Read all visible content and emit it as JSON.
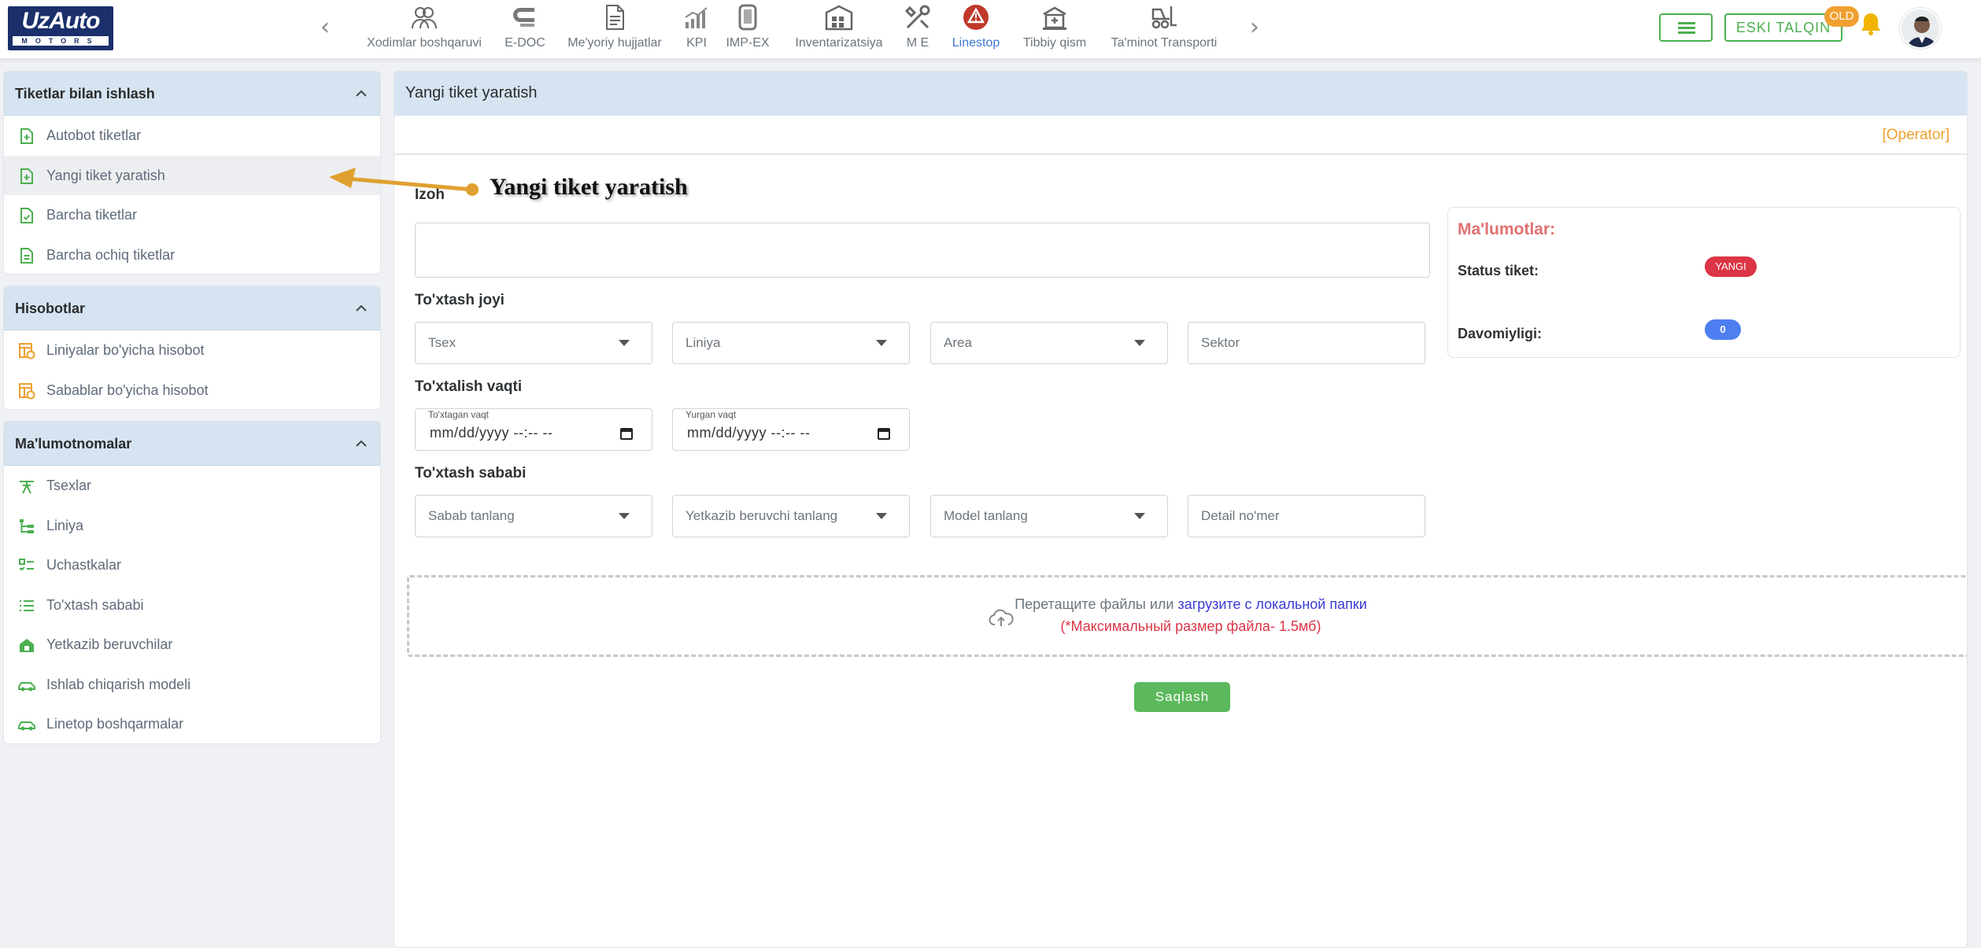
{
  "brand": {
    "name": "UzAuto",
    "sub": "MOTORS"
  },
  "nav": {
    "prev": "‹",
    "next": "›",
    "items": [
      {
        "label": "Xodimlar boshqaruvi",
        "icon": "users-icon"
      },
      {
        "label": "E-DOC",
        "icon": "edoc-icon"
      },
      {
        "label": "Me'yoriy hujjatlar",
        "icon": "document-icon"
      },
      {
        "label": "KPI",
        "icon": "bar-chart-icon"
      },
      {
        "label": "IMP-EX",
        "icon": "tablet-icon"
      },
      {
        "label": "Inventarizatsiya",
        "icon": "warehouse-icon"
      },
      {
        "label": "M E",
        "icon": "tools-icon"
      },
      {
        "label": "Linestop",
        "icon": "warning-triangle-icon",
        "active": true
      },
      {
        "label": "Tibbiy qism",
        "icon": "hospital-icon"
      },
      {
        "label": "Ta'minot Transporti",
        "icon": "forklift-icon"
      }
    ]
  },
  "header": {
    "old_label": "ESKI TALQIN",
    "old_badge": "OLD"
  },
  "sidebar": {
    "groups": [
      {
        "title": "Tiketlar bilan ishlash",
        "items": [
          {
            "label": "Autobot tiketlar",
            "icon": "file-plus-icon"
          },
          {
            "label": "Yangi tiket yaratish",
            "icon": "file-plus-icon",
            "selected": true
          },
          {
            "label": "Barcha tiketlar",
            "icon": "file-check-icon"
          },
          {
            "label": "Barcha ochiq tiketlar",
            "icon": "file-text-icon"
          }
        ]
      },
      {
        "title": "Hisobotlar",
        "items": [
          {
            "label": "Liniyalar bo'yicha hisobot",
            "icon": "report-icon"
          },
          {
            "label": "Sabablar bo'yicha hisobot",
            "icon": "report-icon"
          }
        ]
      },
      {
        "title": "Ma'lumotnomalar",
        "items": [
          {
            "label": "Tsexlar",
            "icon": "workshop-icon"
          },
          {
            "label": "Liniya",
            "icon": "line-tree-icon"
          },
          {
            "label": "Uchastkalar",
            "icon": "sections-icon"
          },
          {
            "label": "To'xtash sababi",
            "icon": "list-icon"
          },
          {
            "label": "Yetkazib beruvchilar",
            "icon": "supplier-icon"
          },
          {
            "label": "Ishlab chiqarish modeli",
            "icon": "car-icon"
          },
          {
            "label": "Linetop boshqarmalar",
            "icon": "car-icon"
          }
        ]
      }
    ]
  },
  "main": {
    "title": "Yangi tiket yaratish",
    "role": "[Operator]",
    "izoh_label": "Izoh",
    "izoh_value": "",
    "location_label": "To'xtash joyi",
    "location": {
      "tsex": "Tsex",
      "liniya": "Liniya",
      "area": "Area",
      "sektor": "Sektor"
    },
    "time_label": "To'xtalish vaqti",
    "time": {
      "stop_label": "To'xtagan vaqt",
      "stop_value": "mm/dd/yyyy --:-- --",
      "run_label": "Yurgan vaqt",
      "run_value": "mm/dd/yyyy --:-- --"
    },
    "reason_label": "To'xtash sababi",
    "reason": {
      "sabab": "Sabab tanlang",
      "supplier": "Yetkazib beruvchi tanlang",
      "model": "Model tanlang",
      "detail": "Detail no'mer"
    },
    "info": {
      "title": "Ma'lumotlar:",
      "status_label": "Status tiket:",
      "status_value": "YANGI",
      "duration_label": "Davomiyligi:",
      "duration_value": "0"
    },
    "upload": {
      "text": "Перетащите файлы или ",
      "link": "загрузите с локальной папки",
      "limit": "(*Максимальный размер файла- 1.5мб)"
    },
    "save_label": "Saqlash"
  },
  "annotation": {
    "text": "Yangi tiket yaratish"
  },
  "colors": {
    "accent_green": "#4caf50",
    "active_blue": "#3d77d6",
    "operator_orange": "#f0a030",
    "status_red": "#dc3545",
    "pill_blue": "#4d7ff0",
    "info_title": "#e07070"
  }
}
